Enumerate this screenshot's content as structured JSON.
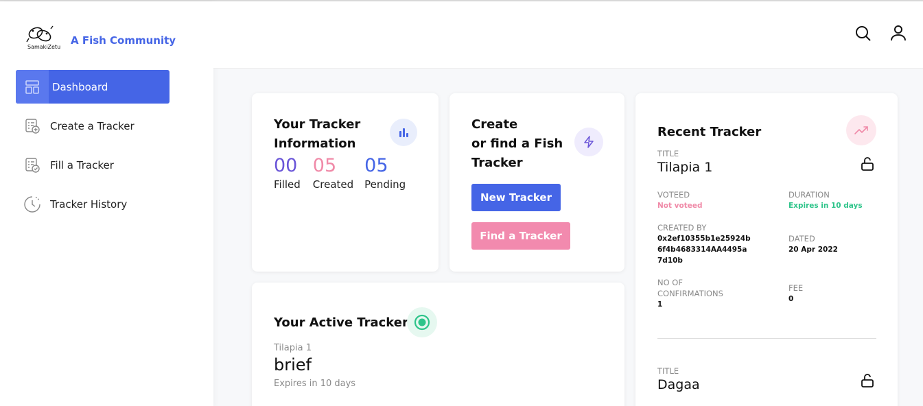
{
  "brand": {
    "logo_text": "SamakiZetu",
    "title": "A Fish Community"
  },
  "sidebar": {
    "items": [
      {
        "label": "Dashboard",
        "icon": "dashboard-icon",
        "active": true
      },
      {
        "label": "Create a Tracker",
        "icon": "create-tracker-icon",
        "active": false
      },
      {
        "label": "Fill a Tracker",
        "icon": "fill-tracker-icon",
        "active": false
      },
      {
        "label": "Tracker History",
        "icon": "history-clock-icon",
        "active": false
      }
    ]
  },
  "header": {
    "icons": [
      "search-icon",
      "user-icon"
    ]
  },
  "tracker_info": {
    "title_line1": "Your Tracker",
    "title_line2": "Information",
    "icon": "bar-chart-icon",
    "stats": [
      {
        "value": "00",
        "label": "Filled",
        "color": "#6a55d8"
      },
      {
        "value": "05",
        "label": "Created",
        "color": "#f08aa8"
      },
      {
        "value": "05",
        "label": "Pending",
        "color": "#4565e6"
      }
    ]
  },
  "create_card": {
    "title_line1": "Create",
    "title_line2": "or find a Fish",
    "title_line3": "Tracker",
    "icon": "lightning-icon",
    "new_button": "New Tracker",
    "find_button": "Find a Tracker"
  },
  "active_tracker": {
    "title": "Your Active Tracker",
    "icon": "target-icon",
    "name": "Tilapia 1",
    "status": "brief",
    "expires": "Expires in 10 days"
  },
  "recent_tracker": {
    "title": "Recent Tracker",
    "icon": "trending-up-icon",
    "entries": [
      {
        "title_label": "TITLE",
        "title": "Tilapia 1",
        "voted_label": "VOTEED",
        "voted": "Not voteed",
        "duration_label": "DURATION",
        "duration": "Expires in 10 days",
        "created_by_label": "CREATED BY",
        "created_by_1": "0x2ef10355b1e25924b",
        "created_by_2": "6f4b4683314AA4495a",
        "created_by_3": "7d10b",
        "dated_label": "DATED",
        "dated": "20 Apr 2022",
        "confirmations_label_1": "NO OF",
        "confirmations_label_2": "CONFIRMATIONS",
        "confirmations": "1",
        "fee_label": "FEE",
        "fee": "0"
      },
      {
        "title_label": "TITLE",
        "title": "Dagaa"
      }
    ]
  },
  "colors": {
    "accent": "#4565e6",
    "pink": "#f08aa8",
    "purple": "#6a55d8",
    "green": "#2ec48a"
  }
}
